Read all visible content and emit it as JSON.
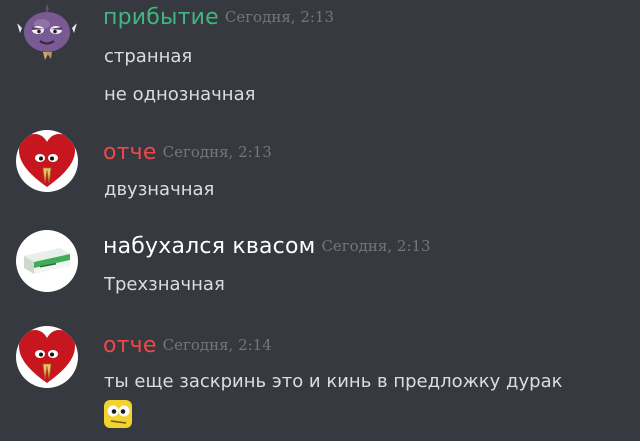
{
  "messages": [
    {
      "username": "прибытие",
      "username_color": "#43b581",
      "timestamp": "Сегодня, 2:13",
      "avatar_icon": "purple-onion-face-avatar",
      "lines": [
        "странная",
        "не однозначная"
      ]
    },
    {
      "username": "отче",
      "username_color": "#f04747",
      "timestamp": "Сегодня, 2:13",
      "avatar_icon": "red-heart-praying-avatar",
      "lines": [
        "двузначная"
      ]
    },
    {
      "username": "набухался квасом",
      "username_color": "#ffffff",
      "timestamp": "Сегодня, 2:13",
      "avatar_icon": "medicine-box-avatar",
      "lines": [
        "Трехзначная"
      ]
    },
    {
      "username": "отче",
      "username_color": "#f04747",
      "timestamp": "Сегодня, 2:14",
      "avatar_icon": "red-heart-praying-avatar",
      "lines": [
        "ты еще заскринь это и кинь в предложку дурак"
      ],
      "emoji": "yellow-face-emoji"
    }
  ]
}
